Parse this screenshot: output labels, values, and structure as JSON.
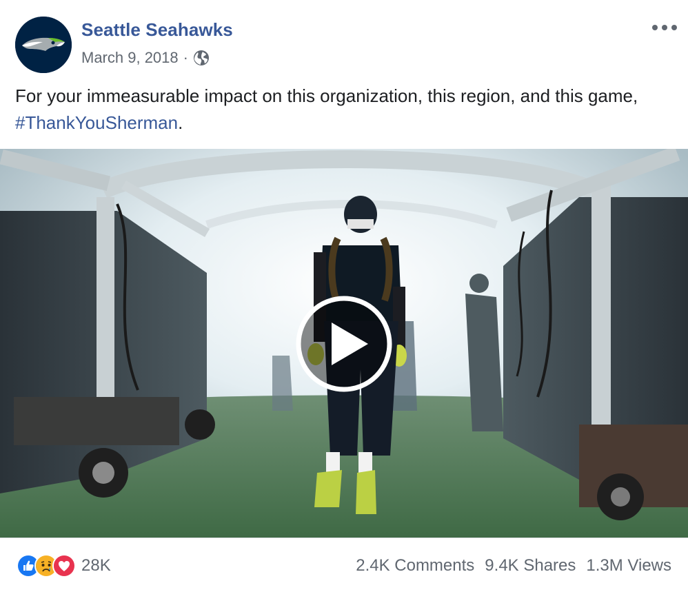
{
  "post": {
    "page_name": "Seattle Seahawks",
    "date": "March 9, 2018",
    "separator": "·",
    "visibility_icon": "globe-icon",
    "more_icon": "more-options-icon",
    "caption_text": "For your immeasurable impact on this organization, this region, and this game, ",
    "hashtag": "#ThankYouSherman",
    "caption_end": "."
  },
  "video": {
    "description_icon": "play-icon"
  },
  "footer": {
    "reaction_icons": [
      "like-icon",
      "sad-icon",
      "love-icon"
    ],
    "reaction_count": "28K",
    "comments": "2.4K Comments",
    "shares": "9.4K Shares",
    "views": "1.3M Views"
  },
  "colors": {
    "link": "#385898",
    "text": "#1c1e21",
    "secondary": "#606770",
    "brand_navy": "#002244",
    "brand_green": "#69BE28"
  }
}
